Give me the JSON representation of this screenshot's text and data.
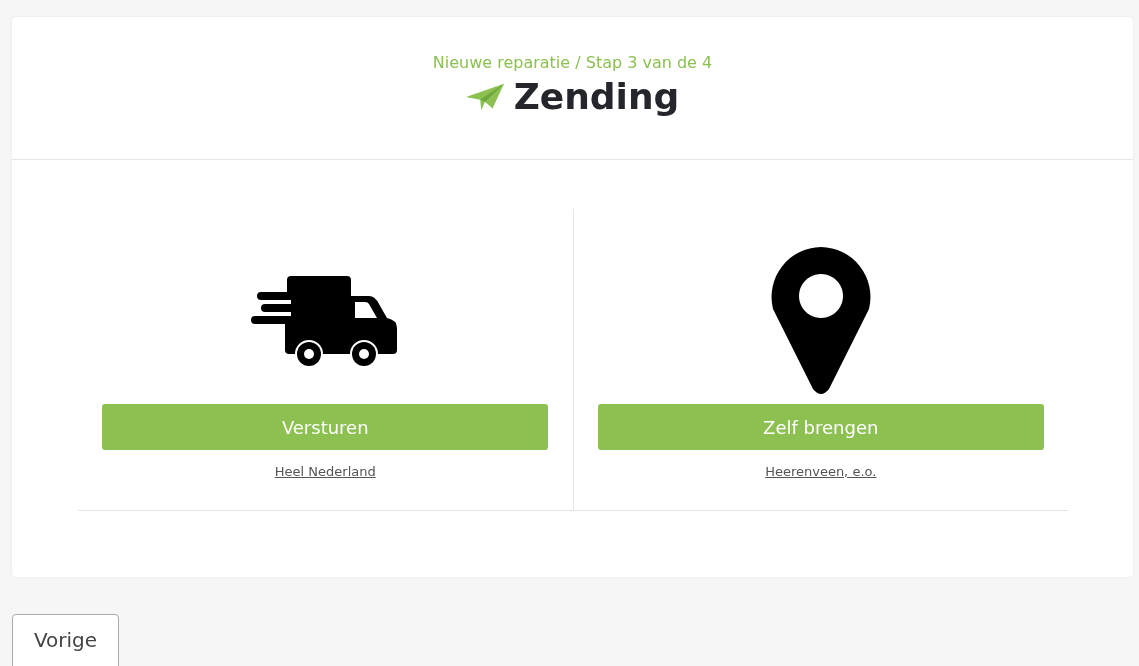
{
  "header": {
    "step": "Nieuwe reparatie / Stap 3 van de 4",
    "title": "Zending"
  },
  "options": [
    {
      "kind": "truck",
      "button": "Versturen",
      "link": "Heel Nederland"
    },
    {
      "kind": "pin",
      "button": "Zelf brengen",
      "link": "Heerenveen, e.o."
    }
  ],
  "back_button": "Vorige"
}
